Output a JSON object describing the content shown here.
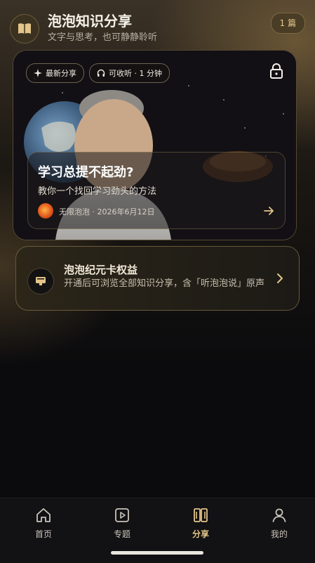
{
  "header": {
    "title": "泡泡知识分享",
    "subtitle": "文字与思考，也可静静聆听",
    "count_badge": "1 篇"
  },
  "feature": {
    "chip_latest": "最新分享",
    "chip_listen": "可收听 · 1 分钟",
    "article_title": "学习总提不起劲?",
    "article_desc": "教你一个找回学习劲头的方法",
    "meta": "无限泡泡 · 2026年6月12日"
  },
  "membership": {
    "title": "泡泡纪元卡权益",
    "desc": "开通后可浏览全部知识分享，含「听泡泡说」原声"
  },
  "tabbar": {
    "items": [
      {
        "label": "首页",
        "icon": "home-icon"
      },
      {
        "label": "专题",
        "icon": "play-square-icon"
      },
      {
        "label": "分享",
        "icon": "book-open-icon"
      },
      {
        "label": "我的",
        "icon": "user-icon"
      }
    ],
    "active_index": 2
  },
  "colors": {
    "accent": "#e3c58a",
    "background": "#0b0b0d",
    "card_border": "#d2af6e"
  }
}
